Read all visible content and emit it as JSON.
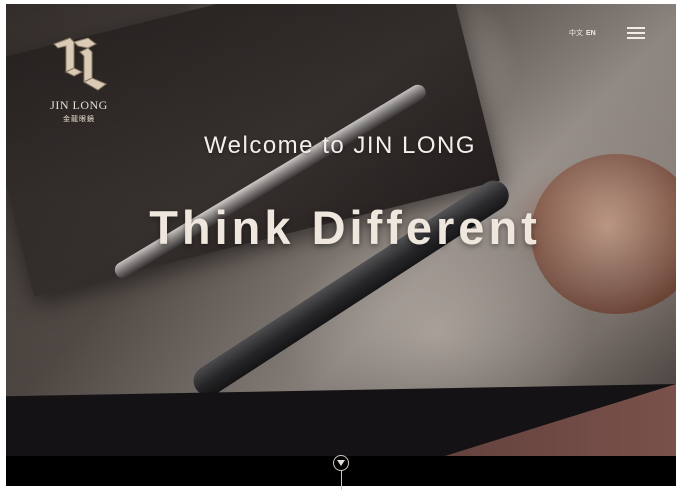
{
  "brand": {
    "name_en": "JIN LONG",
    "name_cn": "金龍眼鏡"
  },
  "header": {
    "languages": [
      {
        "label": "中文",
        "active": false
      },
      {
        "label": "EN",
        "active": true
      }
    ],
    "menu_icon": "hamburger-menu-icon"
  },
  "hero": {
    "welcome": "Welcome to JIN LONG",
    "tagline": "Think Different"
  },
  "scroll": {
    "icon": "chevron-down-icon"
  },
  "colors": {
    "accent": "#7a514b",
    "text_light": "#f3efeb",
    "band_dark": "#141214"
  }
}
